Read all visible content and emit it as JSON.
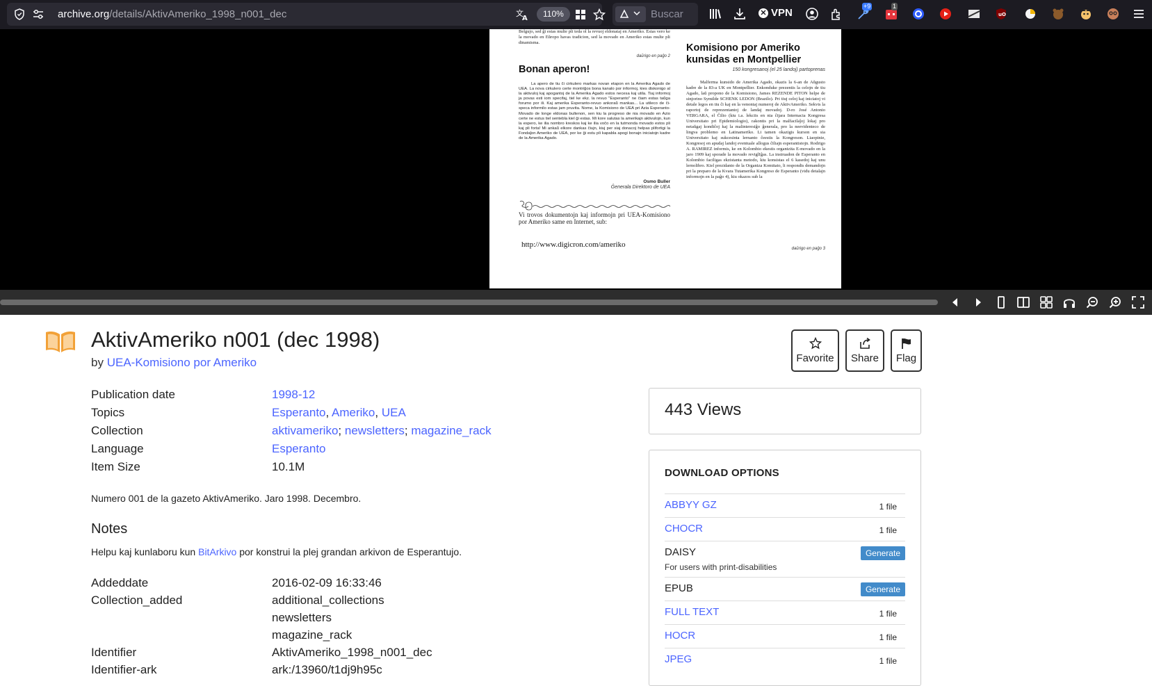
{
  "browser": {
    "url_host": "archive.org",
    "url_path": "/details/AktivAmeriko_1998_n001_dec",
    "zoom": "110%",
    "search_placeholder": "Buscar",
    "vpn_label": "VPN",
    "badge_ext_1": "+9",
    "badge_ext_2": "1"
  },
  "page_scan": {
    "top_text": "Belgujo, sed ĝi estas multe pli teda ol la revuoj eldonataj en Ameriko. Estas vero ke la movado en Eŭropo havas tradicion, sed la movado en Ameriko estas multe pli dinamisma.",
    "continue_left": "daŭrigo en paĝo 2",
    "left_heading": "Bonan aperon!",
    "left_body": "La apero de tiu ĉi cirkulero markas novan etapon en la Amerika Agado de UEA. La nova cirkulero certe montriĝos bona kanalo por informoj, kies diskonigo al la aktivuloj kaj apogantoj de la Amerika Agado estos necesa kaj utila. Tiaj informoj ja povas esti iom specifaj, tiel ke ekz. la revuo \"Esperanto\" ne ĉiam estas taŭga forumo por ili. Kaj amerika Esperanto-revuo ankoraŭ mankas... La utileco de ĉi-specа informilo estas jam pruvita. Nome, la Komisiono de UEA pri Azia Esperanto-Movado de longe eldonas bultenon, sen kiu la progreso de nia movado en Azio certe ne estus tiel sentebla kiel ĝi estas. Mi kore salutas la amerikajn aktivulojn, kun la espero, ke ilia nombro kreskos kaj ke ilia voĉo en la tutmonda movado estos pli kaj pli forta! Mi ankaŭ elkore dankas ĉiujn, kiuj per siaj donacoj helpas plifortigi la Fondaĵon Ameriko de UEA, por ke ĝi estu pli kapabla apogi bonajn iniciatojn kadre de la Amerika Agado.",
    "signature_name": "Osmo Buller",
    "signature_role": "Ĝenerala Direktoro de UEA",
    "promo_text": "Vi trovos dokumentojn kaj informojn pri UEA-Komisiono por Ameriko same en Internet, sub:",
    "promo_url": "http://www.digicron.com/ameriko",
    "right_heading": "Komisiono por Ameriko kunsidas en Montpellier",
    "right_sub": "150 kongresanoj (el 25 landoj) partoprenas",
    "right_body": "Malferma kunsido de Amerika Agado, okazis la 6-an de Aŭgusto kadre de la 83-a UK en Montpellier. Enkonduke prezentis la celojn de tiu Agado, laŭ propono de la Komisiono, James REZENDE PITON helpe de sinjorino Symilde SCHENK LEDON (Brazilo). Pri tiuj celoj kaj iniciatoj vi detale legos en tiu ĉi kaj en la venontaj numeroj de AktivAmeriko. Sekvis la raportoj de reprezentantoj de landaj movadoj. D-ro José Antonio VERGARA, el Ĉilio (kiu i.a. lekciis en nia ĉijara Internacia Kongresa Universitato pri Epidemiologio), rakontis pri la malfacilaĵoj lokaj pro netaŭgaj kondiĉoj kaj la malinteresiĝo ĝenerala, pro la neevidenteco de lingva problemo en Latinameriko. Li tamen okazigis kurson en sia Universitato kaj sukcesinta lernanto ĉeestis la Kongreson. Liaopinie, Kongresoj en apudaj landoj eventuale allogus ĉiliajn esperantistojn. Rodrigo A. RAMIREZ informis, ke en Kolombio ekestis organizita E-movado en la jaro 1909 kaj sporade la movado reviglIĝas. La instruadon de Esperanto en Kolombio faciligas ekzistanta metodo, kiu konsistas el 6 kasedoj kaj unu lernolibro. Kiel prezidanto de la Organiza Komitato, li respondis demandojn pri la preparo de la Kvara Tutamerika Kongreso de Esperanto (vidu detalajn informojn en la paĝo 4), kiu okazos sub la",
    "continue_right": "daŭrigo en paĝo 3"
  },
  "item": {
    "title": "AktivAmeriko n001 (dec 1998)",
    "by_prefix": "by",
    "creator": "UEA-Komisiono por Ameriko",
    "actions": [
      {
        "label": "Favorite",
        "icon": "star-icon"
      },
      {
        "label": "Share",
        "icon": "share-icon"
      },
      {
        "label": "Flag",
        "icon": "flag-icon"
      }
    ],
    "metadata": {
      "publication_date_label": "Publication date",
      "publication_date": "1998-12",
      "topics_label": "Topics",
      "topics": [
        "Esperanto",
        "Ameriko",
        "UEA"
      ],
      "collection_label": "Collection",
      "collections": [
        "aktivameriko",
        "newsletters",
        "magazine_rack"
      ],
      "language_label": "Language",
      "language": "Esperanto",
      "item_size_label": "Item Size",
      "item_size": "10.1M"
    },
    "description": "Numero 001 de la gazeto AktivAmeriko. Jaro 1998. Decembro.",
    "notes_heading": "Notes",
    "notes_before": "Helpu kaj kunlaboru kun ",
    "notes_link": "BitArkivo",
    "notes_after": " por konstrui la plej grandan arkivon de Esperantujo.",
    "extra": {
      "addeddate_label": "Addeddate",
      "addeddate": "2016-02-09 16:33:46",
      "collection_added_label": "Collection_added",
      "collection_added": [
        "additional_collections",
        "newsletters",
        "magazine_rack"
      ],
      "identifier_label": "Identifier",
      "identifier": "AktivAmeriko_1998_n001_dec",
      "identifier_ark_label": "Identifier-ark",
      "identifier_ark": "ark:/13960/t1dj9h95c"
    }
  },
  "views": "443 Views",
  "downloads": {
    "heading": "DOWNLOAD OPTIONS",
    "rows": [
      {
        "name": "ABBYY GZ",
        "count": "1 file"
      },
      {
        "name": "CHOCR",
        "count": "1 file"
      },
      {
        "name": "DAISY",
        "button": "Generate",
        "sub": "For users with print-disabilities"
      },
      {
        "name": "EPUB",
        "button": "Generate"
      },
      {
        "name": "FULL TEXT",
        "count": "1 file"
      },
      {
        "name": "HOCR",
        "count": "1 file"
      },
      {
        "name": "JPEG",
        "count": "1 file"
      }
    ]
  },
  "colors": {
    "link": "#4b64ff",
    "generate": "#428bca",
    "book_icon": "#f2a137"
  }
}
